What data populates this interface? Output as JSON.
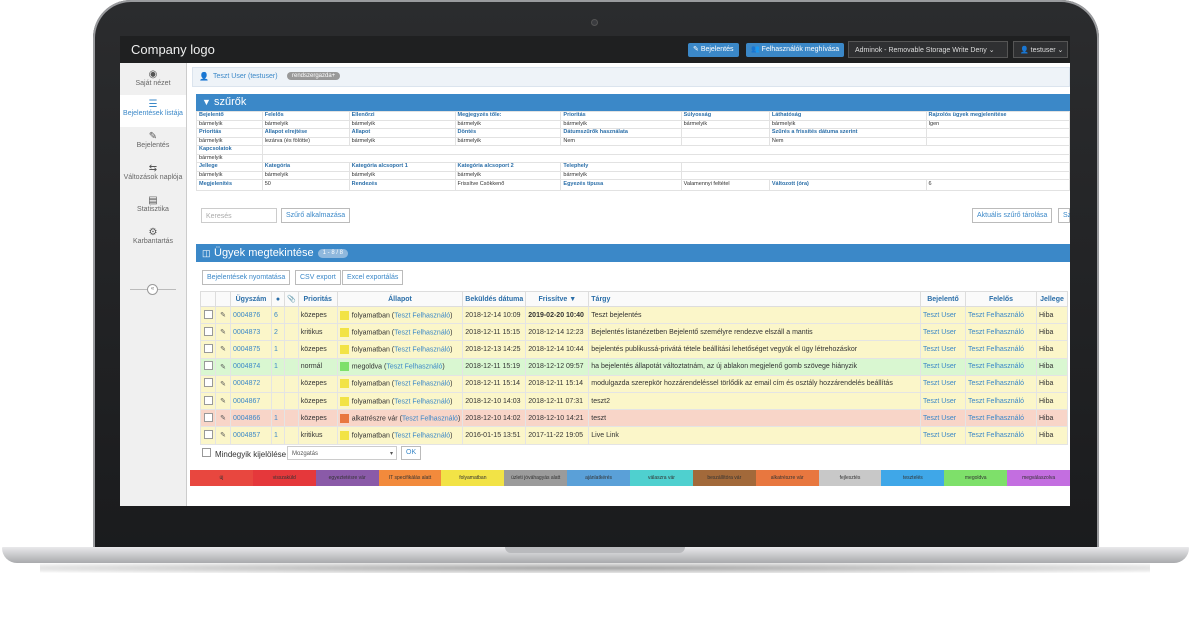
{
  "app": {
    "logo": "Company logo"
  },
  "topbar": {
    "report_btn": "Bejelentés",
    "invite_btn": "Felhasználók meghívása",
    "admin_select": "Adminok - Removable Storage Write Deny",
    "user_select": "testuser"
  },
  "sidebar": {
    "items": [
      {
        "label": "Saját nézet",
        "icon": "tachometer-icon"
      },
      {
        "label": "Bejelentések listája",
        "icon": "list-icon"
      },
      {
        "label": "Bejelentés",
        "icon": "edit-icon"
      },
      {
        "label": "Változások naplója",
        "icon": "exchange-icon"
      },
      {
        "label": "Statisztika",
        "icon": "bar-chart-icon"
      },
      {
        "label": "Karbantartás",
        "icon": "gears-icon"
      }
    ]
  },
  "userbar": {
    "user": "Teszt User (testuser)",
    "role": "rendszergazda+"
  },
  "filters": {
    "title": "szűrők",
    "row1_labels": [
      "Bejelentő",
      "Felelős",
      "Ellenőrzi",
      "Megjegyzés tőle:",
      "Prioritás",
      "Súlyosság",
      "Láthatóság",
      "Rajzolós ügyek megjelenítése"
    ],
    "row1_values": [
      "bármelyik",
      "bármelyik",
      "bármelyik",
      "bármelyik",
      "bármelyik",
      "bármelyik",
      "bármelyik",
      "Igen"
    ],
    "row2_labels": [
      "Prioritás",
      "Állapot elrejtése",
      "Állapot",
      "Döntés",
      "Dátumszűrők használata",
      "",
      "Szűrés a frissítés dátuma szerint",
      ""
    ],
    "row2_values": [
      "bármelyik",
      "lezárva (és fölötte)",
      "bármelyik",
      "bármelyik",
      "Nem",
      "",
      "Nem",
      ""
    ],
    "row3_label": "Kapcsolatok",
    "row3_value": "bármelyik",
    "row4_labels": [
      "Jellege",
      "Kategória",
      "Kategória alcsoport 1",
      "Kategória alcsoport 2",
      "Telephely"
    ],
    "row4_values": [
      "bármelyik",
      "bármelyik",
      "bármelyik",
      "bármelyik",
      "bármelyik"
    ],
    "row5": [
      "Megjelenítés",
      "50",
      "Rendezés",
      "Frissítve Csökkenő",
      "Egyezés típusa",
      "Valamennyi feltétel",
      "Változott (óra)",
      "6"
    ],
    "search_placeholder": "Keresés",
    "apply_btn": "Szűrő alkalmazása",
    "save_btn": "Aktuális szűrő tárolása",
    "extra_btn": "Sz"
  },
  "issues": {
    "title": "Ügyek megtekintése",
    "count": "1 - 8 / 8",
    "print_btn": "Bejelentések nyomtatása",
    "csv_btn": "CSV export",
    "excel_btn": "Excel exportálás",
    "columns": [
      "Ügyszám",
      "",
      "",
      "Prioritás",
      "Állapot",
      "Beküldés dátuma",
      "Frissítve",
      "Tárgy",
      "Bejelentő",
      "Felelős",
      "Jellege"
    ],
    "rows": [
      {
        "id": "0004876",
        "notes": "6",
        "prio": "közepes",
        "status": "folyamatban",
        "assignee": "Teszt Felhasználó",
        "sent": "2018-12-14 10:09",
        "updated": "2019-02-20 10:40",
        "subject": "Teszt bejelentés",
        "reporter": "Teszt User",
        "owner": "Teszt Felhasználó",
        "type": "Hiba",
        "bg": "#fbf6c9",
        "sw": "#f2e346"
      },
      {
        "id": "0004873",
        "notes": "2",
        "prio": "kritikus",
        "status": "folyamatban",
        "assignee": "Teszt Felhasználó",
        "sent": "2018-12-11 15:15",
        "updated": "2018-12-14 12:23",
        "subject": "Bejelentés listanézetben Bejelentő személyre rendezve elszáll a mantis",
        "reporter": "Teszt User",
        "owner": "Teszt Felhasználó",
        "type": "Hiba",
        "bg": "#fbf6c9",
        "sw": "#f2e346"
      },
      {
        "id": "0004875",
        "notes": "1",
        "prio": "közepes",
        "status": "folyamatban",
        "assignee": "Teszt Felhasználó",
        "sent": "2018-12-13 14:25",
        "updated": "2018-12-14 10:44",
        "subject": "bejelentés publikussá-privátá tétele beállítási lehetőséget vegyük el ügy létrehozáskor",
        "reporter": "Teszt User",
        "owner": "Teszt Felhasználó",
        "type": "Hiba",
        "bg": "#fbf6c9",
        "sw": "#f2e346"
      },
      {
        "id": "0004874",
        "notes": "1",
        "prio": "normál",
        "status": "megoldva",
        "assignee": "Teszt Felhasználó",
        "sent": "2018-12-11 15:19",
        "updated": "2018-12-12 09:57",
        "subject": "ha bejelentés állapotát változtatnám, az új ablakon megjelenő gomb szövege hiányzik",
        "reporter": "Teszt User",
        "owner": "Teszt Felhasználó",
        "type": "Hiba",
        "bg": "#d9f7d1",
        "sw": "#7ee06a"
      },
      {
        "id": "0004872",
        "notes": "",
        "prio": "közepes",
        "status": "folyamatban",
        "assignee": "Teszt Felhasználó",
        "sent": "2018-12-11 15:14",
        "updated": "2018-12-11 15:14",
        "subject": "modulgazda szerepkör hozzárendeléssel törlődik az email cím és osztály hozzárendelés beállítás",
        "reporter": "Teszt User",
        "owner": "Teszt Felhasználó",
        "type": "Hiba",
        "bg": "#fbf6c9",
        "sw": "#f2e346"
      },
      {
        "id": "0004867",
        "notes": "",
        "prio": "közepes",
        "status": "folyamatban",
        "assignee": "Teszt Felhasználó",
        "sent": "2018-12-10 14:03",
        "updated": "2018-12-11 07:31",
        "subject": "teszt2",
        "reporter": "Teszt User",
        "owner": "Teszt Felhasználó",
        "type": "Hiba",
        "bg": "#fbf6c9",
        "sw": "#f2e346"
      },
      {
        "id": "0004866",
        "notes": "1",
        "prio": "közepes",
        "status": "alkatrészre vár",
        "assignee": "Teszt Felhasználó",
        "sent": "2018-12-10 14:02",
        "updated": "2018-12-10 14:21",
        "subject": "teszt",
        "reporter": "Teszt User",
        "owner": "Teszt Felhasználó",
        "type": "Hiba",
        "bg": "#f8d5c8",
        "sw": "#e8773f"
      },
      {
        "id": "0004857",
        "notes": "1",
        "prio": "kritikus",
        "status": "folyamatban",
        "assignee": "Teszt Felhasználó",
        "sent": "2016-01-15 13:51",
        "updated": "2017-11-22 19:05",
        "subject": "Live Link",
        "reporter": "Teszt User",
        "owner": "Teszt Felhasználó",
        "type": "Hiba",
        "bg": "#fbf6c9",
        "sw": "#f2e346"
      }
    ],
    "select_all": "Mindegyik kijelölése",
    "action_select": "Mozgatás",
    "ok_btn": "OK"
  },
  "legend": [
    {
      "label": "új",
      "color": "#e8473f"
    },
    {
      "label": "visszaküld",
      "color": "#e5383b"
    },
    {
      "label": "egyeztetésre vár",
      "color": "#8a5aa8"
    },
    {
      "label": "IT specifikálás alatt",
      "color": "#f28a3c"
    },
    {
      "label": "folyamatban",
      "color": "#f2e346"
    },
    {
      "label": "üzleti jóváhagyás alatt",
      "color": "#9b9b9b"
    },
    {
      "label": "ajánlatkérés",
      "color": "#5aa0d8"
    },
    {
      "label": "válaszra vár",
      "color": "#4fd0cf"
    },
    {
      "label": "beszállítóra vár",
      "color": "#a2693a"
    },
    {
      "label": "alkatrészre vár",
      "color": "#e8773f"
    },
    {
      "label": "fejlesztés",
      "color": "#c8c8c8"
    },
    {
      "label": "tesztelés",
      "color": "#3fa7e8"
    },
    {
      "label": "megoldva",
      "color": "#7ee06a"
    },
    {
      "label": "megválaszolva",
      "color": "#c36ee0"
    }
  ]
}
